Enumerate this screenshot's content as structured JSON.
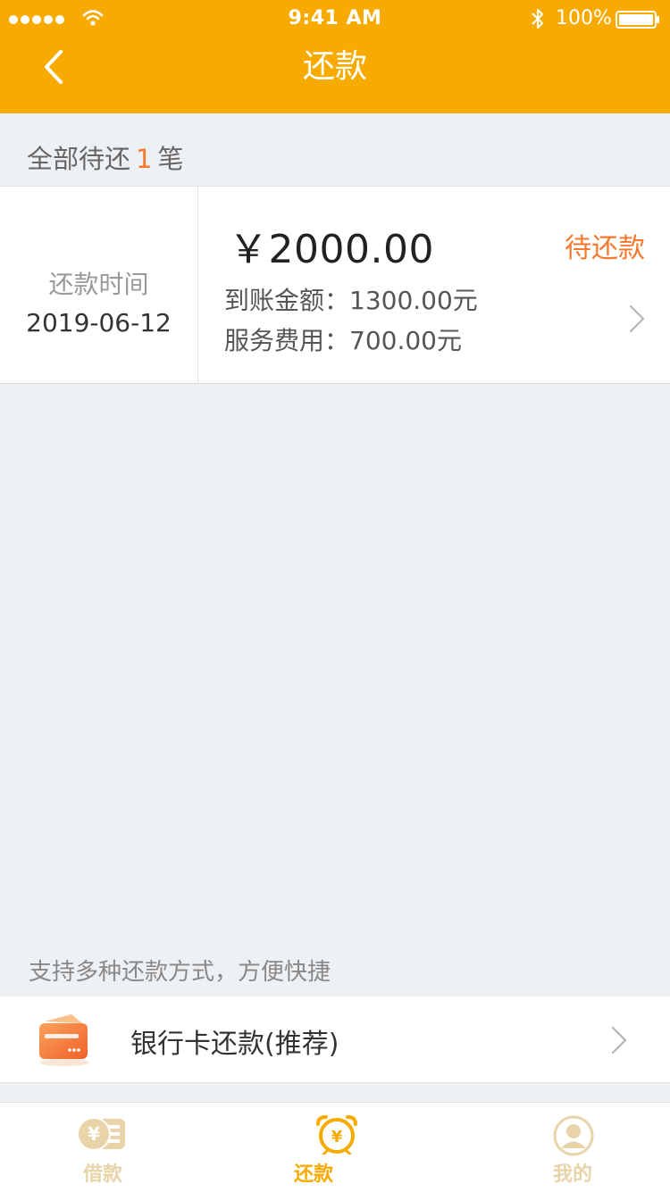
{
  "status_bar": {
    "time": "9:41 AM",
    "battery": "100%"
  },
  "nav": {
    "title": "还款"
  },
  "summary": {
    "prefix": "全部待还",
    "count": "1",
    "suffix": "笔"
  },
  "repayment": {
    "date_label": "还款时间",
    "date": "2019-06-12",
    "amount": "￥2000.00",
    "status": "待还款",
    "received": "到账金额：1300.00元",
    "service_fee": "服务费用：700.00元"
  },
  "methods": {
    "title": "支持多种还款方式，方便快捷",
    "items": [
      {
        "label": "银行卡还款(推荐)",
        "icon": "bank-card-icon"
      }
    ]
  },
  "tabs": [
    {
      "label": "借款",
      "icon": "loan-icon",
      "active": false
    },
    {
      "label": "还款",
      "icon": "repay-clock-icon",
      "active": true
    },
    {
      "label": "我的",
      "icon": "profile-icon",
      "active": false
    }
  ],
  "colors": {
    "brand": "#f7aa00",
    "accent": "#f6782c",
    "background": "#eef1f4",
    "tab_inactive": "#e8d4a8"
  }
}
